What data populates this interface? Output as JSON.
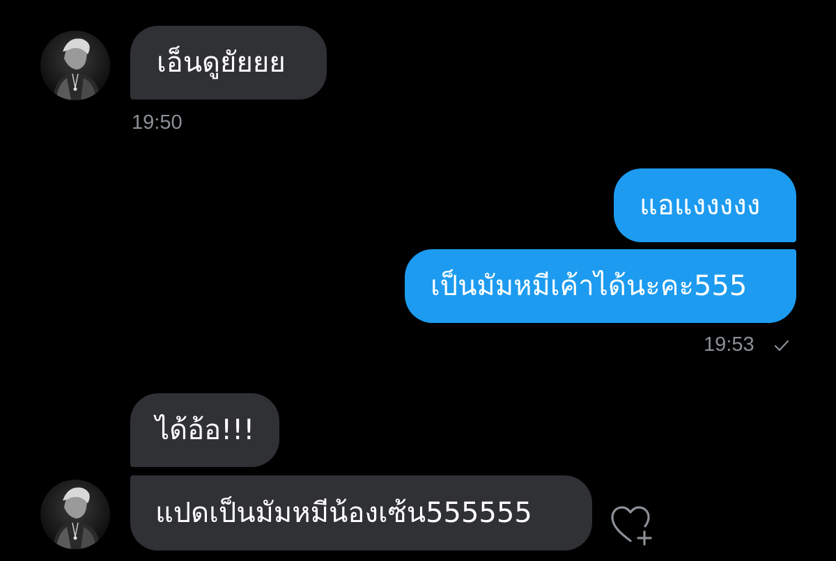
{
  "conversation": {
    "messages": [
      {
        "direction": "incoming",
        "text": "เอ็นดูยัยยย",
        "timestamp": "19:50"
      },
      {
        "direction": "outgoing",
        "text": "แอแงงงงง"
      },
      {
        "direction": "outgoing",
        "text": "เป็นมัมหมีเค้าได้นะคะ555",
        "timestamp": "19:53"
      },
      {
        "direction": "incoming",
        "text": "ได้อ้อ!!!"
      },
      {
        "direction": "incoming",
        "text": "แปดเป็นมัมหมีน้องเซ้น555555"
      }
    ]
  },
  "colors": {
    "background": "#000000",
    "incoming_bubble": "#303135",
    "outgoing_bubble": "#1d9bf0",
    "timestamp": "#8b9096",
    "icon": "#8b9096"
  },
  "icons": {
    "sent_status": "checkmark-icon",
    "reaction": "heart-plus-icon",
    "avatar": "contact-avatar"
  }
}
